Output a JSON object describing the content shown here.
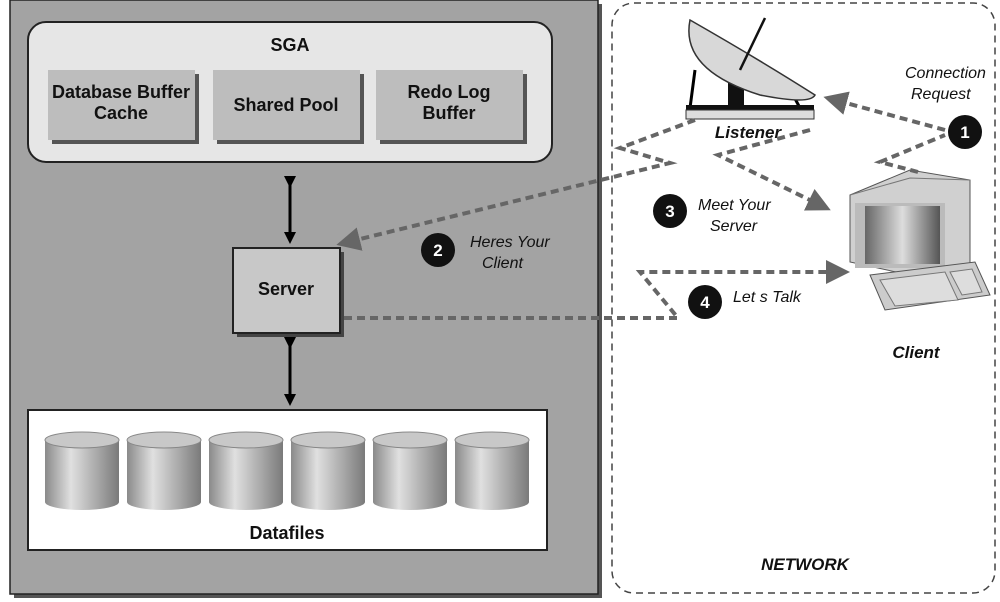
{
  "sga": {
    "title": "SGA",
    "components": [
      [
        "Database Buffer",
        "Cache"
      ],
      [
        "Shared Pool"
      ],
      [
        "Redo Log",
        "Buffer"
      ]
    ]
  },
  "server": "Server",
  "datafiles": {
    "label": "Datafiles",
    "cylinder_count": 6
  },
  "network": "NETWORK",
  "listener": "Listener",
  "client": "Client",
  "steps": [
    {
      "num": "1",
      "text": [
        "Connection",
        "Request"
      ]
    },
    {
      "num": "2",
      "text": [
        "Heres Your",
        "Client"
      ]
    },
    {
      "num": "3",
      "text": [
        "Meet Your",
        "Server"
      ]
    },
    {
      "num": "4",
      "text": [
        "Let s Talk"
      ]
    }
  ],
  "colors": {
    "instance_bg": "#a3a3a3",
    "sga_bg": "#e6e6e6",
    "arrow": "#666666"
  }
}
